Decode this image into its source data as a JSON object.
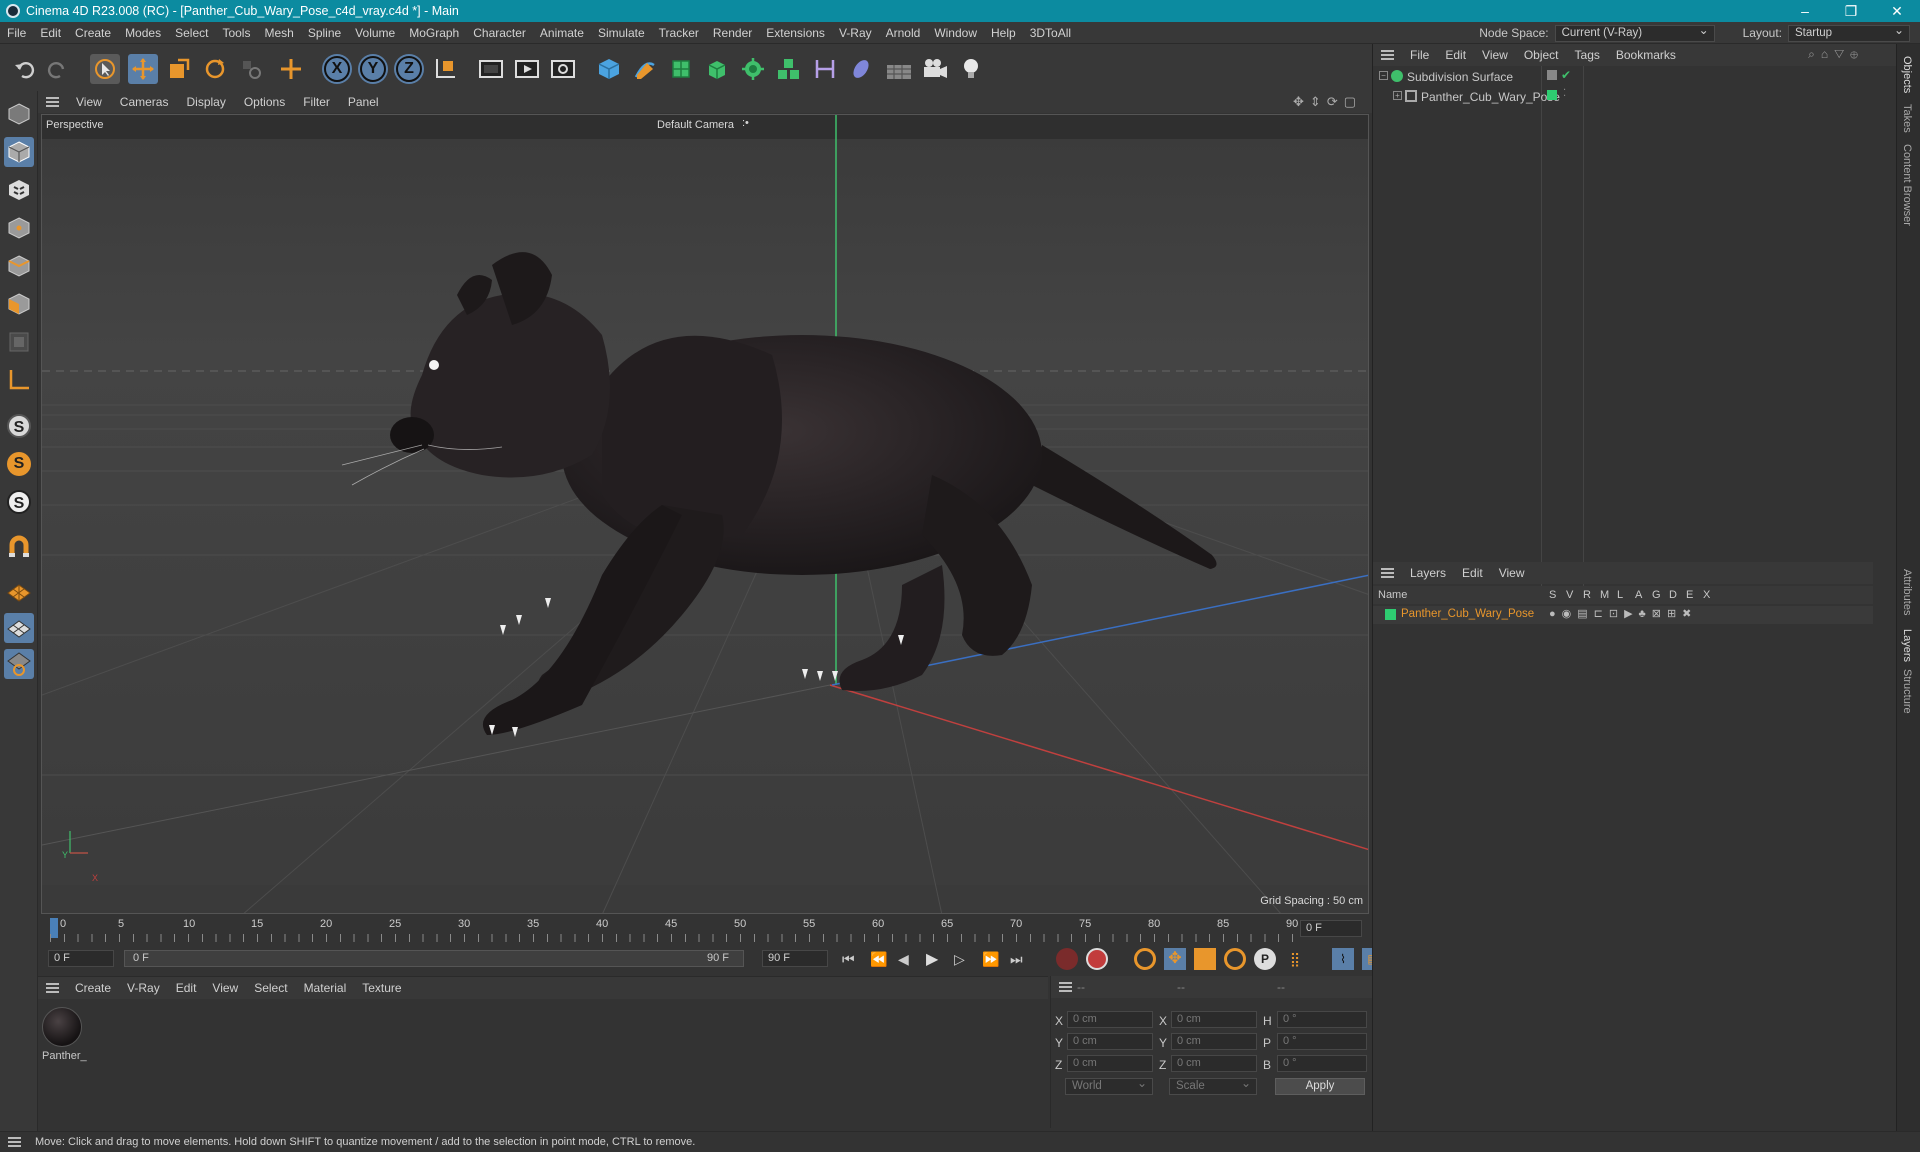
{
  "window": {
    "title": "Cinema 4D R23.008 (RC) - [Panther_Cub_Wary_Pose_c4d_vray.c4d *] - Main",
    "controls": [
      "–",
      "❐",
      "✕"
    ]
  },
  "menubar": {
    "items": [
      "File",
      "Edit",
      "Create",
      "Modes",
      "Select",
      "Tools",
      "Mesh",
      "Spline",
      "Volume",
      "MoGraph",
      "Character",
      "Animate",
      "Simulate",
      "Tracker",
      "Render",
      "Extensions",
      "V-Ray",
      "Arnold",
      "Window",
      "Help",
      "3DToAll"
    ],
    "node_space_label": "Node Space:",
    "node_space_value": "Current (V-Ray)",
    "layout_label": "Layout:",
    "layout_value": "Startup"
  },
  "toolbar": {
    "icons": [
      "undo-icon",
      "redo-icon",
      "select-icon",
      "move-icon",
      "scale-icon",
      "rotate-icon",
      "recent-icon",
      "add-icon",
      "x-axis-icon",
      "y-axis-icon",
      "z-axis-icon",
      "coordinate-icon",
      "render-region-icon",
      "render-view-icon",
      "render-settings-icon",
      "cube-icon",
      "pen-icon",
      "subdivision-icon",
      "extrude-icon",
      "mograph-icon",
      "cloner-icon",
      "deformer-icon",
      "field-icon",
      "floor-icon",
      "camera-icon",
      "light-icon"
    ],
    "axis_labels": [
      "X",
      "Y",
      "Z"
    ]
  },
  "left_tools": {
    "icons": [
      "model-mode-icon",
      "texture-mode-icon",
      "point-mode-icon",
      "edge-mode-icon",
      "polygon-mode-icon",
      "uv-mode-icon",
      "axis-mode-icon",
      "snap-s1-icon",
      "snap-s2-icon",
      "snap-s3-icon",
      "magnet-icon",
      "grid-plane-icon",
      "workplane-icon",
      "workplane-lock-icon"
    ],
    "snap_letters": [
      "S",
      "S",
      "S"
    ]
  },
  "viewport": {
    "menu": [
      "View",
      "Cameras",
      "Display",
      "Options",
      "Filter",
      "Panel"
    ],
    "view_name": "Perspective",
    "camera": "Default Camera",
    "camera_suffix": ":•",
    "grid_spacing": "Grid Spacing : 50 cm",
    "axis_y": "Y",
    "axis_x": "X"
  },
  "timeline": {
    "ticks": [
      "0",
      "5",
      "10",
      "15",
      "20",
      "25",
      "30",
      "35",
      "40",
      "45",
      "50",
      "55",
      "60",
      "65",
      "70",
      "75",
      "80",
      "85",
      "90"
    ],
    "current_frame": "0 F",
    "start_frame": "0 F",
    "range_start": "0 F",
    "range_end": "90 F",
    "end_frame": "90 F",
    "right_frame": "0 F"
  },
  "material_manager": {
    "menu": [
      "Create",
      "V-Ray",
      "Edit",
      "View",
      "Select",
      "Material",
      "Texture"
    ],
    "materials": [
      {
        "name": "Panther_"
      }
    ]
  },
  "coordinates": {
    "header": [
      "--",
      "--",
      "--"
    ],
    "rows": [
      {
        "a_label": "X",
        "a_value": "0 cm",
        "b_label": "X",
        "b_value": "0 cm",
        "c_label": "H",
        "c_value": "0 °"
      },
      {
        "a_label": "Y",
        "a_value": "0 cm",
        "b_label": "Y",
        "b_value": "0 cm",
        "c_label": "P",
        "c_value": "0 °"
      },
      {
        "a_label": "Z",
        "a_value": "0 cm",
        "b_label": "Z",
        "b_value": "0 cm",
        "c_label": "B",
        "c_value": "0 °"
      }
    ],
    "space": "World",
    "mode": "Scale",
    "apply": "Apply"
  },
  "object_manager": {
    "menu": [
      "File",
      "Edit",
      "View",
      "Object",
      "Tags",
      "Bookmarks"
    ],
    "objects": [
      {
        "name": "Subdivision Surface"
      },
      {
        "name": "Panther_Cub_Wary_Pose"
      }
    ]
  },
  "layers_manager": {
    "menu": [
      "Layers",
      "Edit",
      "View"
    ],
    "columns": [
      "Name",
      "S",
      "V",
      "R",
      "M",
      "L",
      "A",
      "G",
      "D",
      "E",
      "X"
    ],
    "layers": [
      {
        "name": "Panther_Cub_Wary_Pose",
        "color": "#2ecc71"
      }
    ]
  },
  "side_tabs": [
    "Objects",
    "Takes",
    "Content Browser",
    "Attributes",
    "Layers",
    "Structure"
  ],
  "status": {
    "text": "Move: Click and drag to move elements. Hold down SHIFT to quantize movement / add to the selection in point mode, CTRL to remove."
  },
  "colors": {
    "titlebar": "#0c8ba0",
    "accent_orange": "#e8962c",
    "layer_green": "#2ecc71",
    "axis_green": "#3fbf6b",
    "axis_red": "#c0403e",
    "axis_blue": "#3a6fc2"
  }
}
